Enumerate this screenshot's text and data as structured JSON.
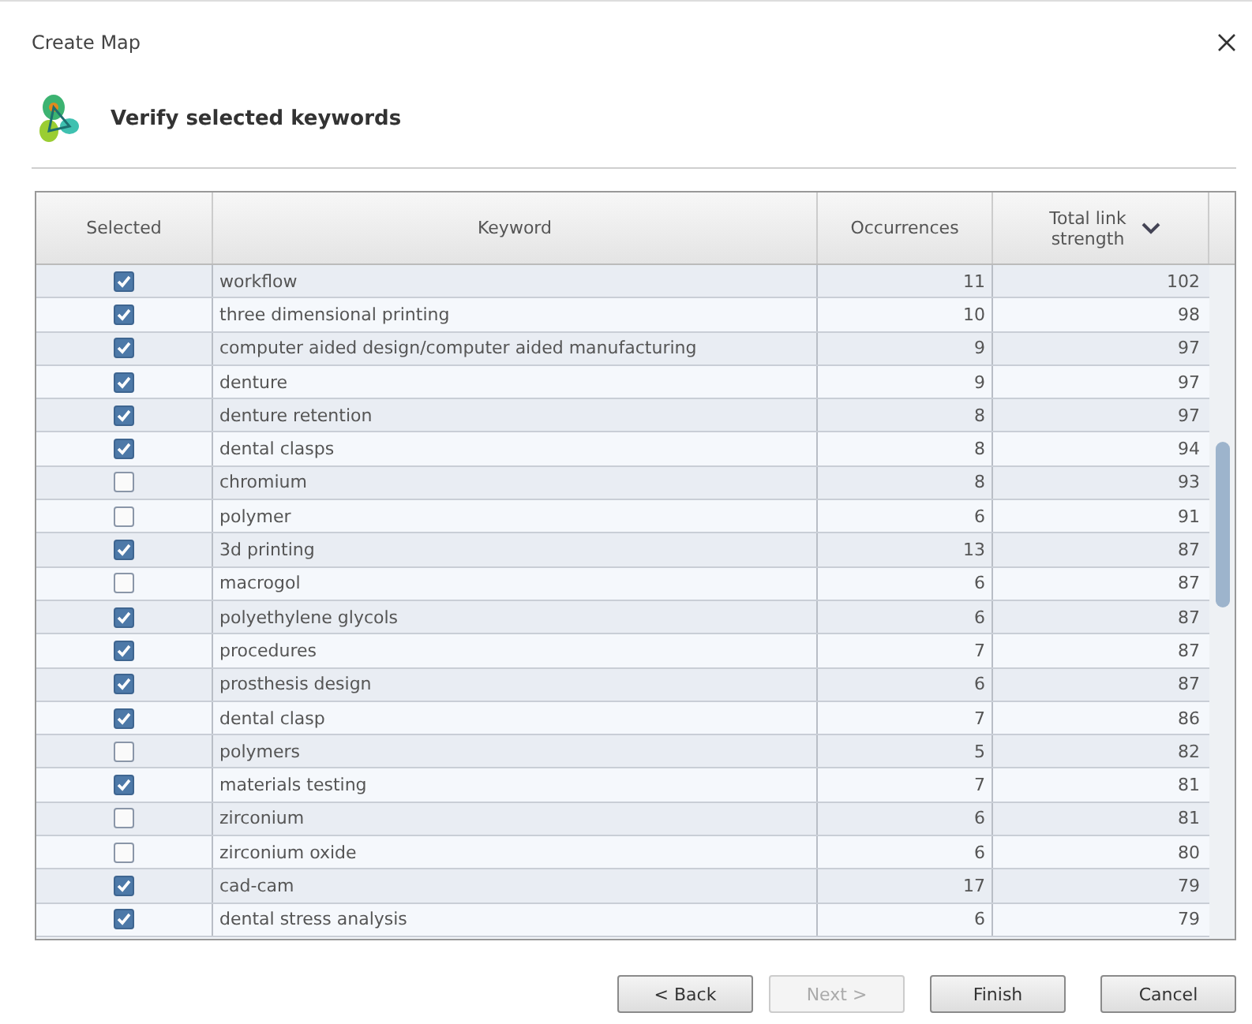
{
  "window": {
    "title": "Create Map"
  },
  "header": {
    "title": "Verify selected keywords"
  },
  "table": {
    "columns": [
      {
        "label": "Selected"
      },
      {
        "label": "Keyword"
      },
      {
        "label": "Occurrences"
      },
      {
        "label": "Total link strength",
        "sorted": true
      }
    ],
    "rows": [
      {
        "checked": true,
        "keyword": "workflow",
        "occurrences": "11",
        "strength": "102"
      },
      {
        "checked": true,
        "keyword": "three dimensional printing",
        "occurrences": "10",
        "strength": "98"
      },
      {
        "checked": true,
        "keyword": "computer aided design/computer aided manufacturing",
        "occurrences": "9",
        "strength": "97"
      },
      {
        "checked": true,
        "keyword": "denture",
        "occurrences": "9",
        "strength": "97"
      },
      {
        "checked": true,
        "keyword": "denture retention",
        "occurrences": "8",
        "strength": "97"
      },
      {
        "checked": true,
        "keyword": "dental clasps",
        "occurrences": "8",
        "strength": "94"
      },
      {
        "checked": false,
        "keyword": "chromium",
        "occurrences": "8",
        "strength": "93"
      },
      {
        "checked": false,
        "keyword": "polymer",
        "occurrences": "6",
        "strength": "91"
      },
      {
        "checked": true,
        "keyword": "3d printing",
        "occurrences": "13",
        "strength": "87"
      },
      {
        "checked": false,
        "keyword": "macrogol",
        "occurrences": "6",
        "strength": "87"
      },
      {
        "checked": true,
        "keyword": "polyethylene glycols",
        "occurrences": "6",
        "strength": "87"
      },
      {
        "checked": true,
        "keyword": "procedures",
        "occurrences": "7",
        "strength": "87"
      },
      {
        "checked": true,
        "keyword": "prosthesis design",
        "occurrences": "6",
        "strength": "87"
      },
      {
        "checked": true,
        "keyword": "dental clasp",
        "occurrences": "7",
        "strength": "86"
      },
      {
        "checked": false,
        "keyword": "polymers",
        "occurrences": "5",
        "strength": "82"
      },
      {
        "checked": true,
        "keyword": "materials testing",
        "occurrences": "7",
        "strength": "81"
      },
      {
        "checked": false,
        "keyword": "zirconium",
        "occurrences": "6",
        "strength": "81"
      },
      {
        "checked": false,
        "keyword": "zirconium oxide",
        "occurrences": "6",
        "strength": "80"
      },
      {
        "checked": true,
        "keyword": "cad-cam",
        "occurrences": "17",
        "strength": "79"
      },
      {
        "checked": true,
        "keyword": "dental stress analysis",
        "occurrences": "6",
        "strength": "79"
      }
    ]
  },
  "buttons": [
    {
      "label": "< Back",
      "disabled": false
    },
    {
      "label": "Next >",
      "disabled": true
    },
    {
      "label": "Finish",
      "disabled": false
    },
    {
      "label": "Cancel",
      "disabled": false
    }
  ]
}
